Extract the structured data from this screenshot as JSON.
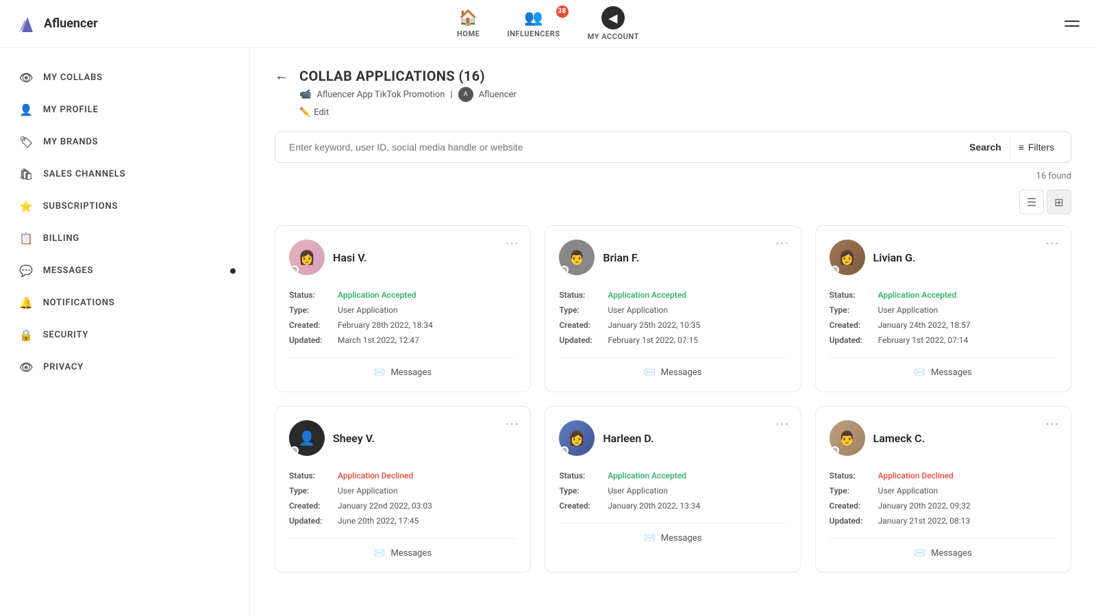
{
  "app": {
    "name": "Afluencer"
  },
  "topNav": {
    "badge": "38",
    "items": [
      {
        "id": "home",
        "label": "HOME",
        "icon": "🏠"
      },
      {
        "id": "influencers",
        "label": "INFLUENCERS",
        "icon": "👥"
      },
      {
        "id": "my-account",
        "label": "MY ACCOUNT",
        "icon": "◀"
      }
    ]
  },
  "sidebar": {
    "items": [
      {
        "id": "my-collabs",
        "label": "MY COLLABS",
        "icon": "👁",
        "dot": false
      },
      {
        "id": "my-profile",
        "label": "MY PROFILE",
        "icon": "👤",
        "dot": false
      },
      {
        "id": "my-brands",
        "label": "MY BRANDS",
        "icon": "🏷",
        "dot": false
      },
      {
        "id": "sales-channels",
        "label": "SALES CHANNELS",
        "icon": "🛍",
        "dot": false
      },
      {
        "id": "subscriptions",
        "label": "SUBSCRIPTIONS",
        "icon": "⭐",
        "dot": false
      },
      {
        "id": "billing",
        "label": "BILLING",
        "icon": "📋",
        "dot": false
      },
      {
        "id": "messages",
        "label": "MESSAGES",
        "icon": "💬",
        "dot": true
      },
      {
        "id": "notifications",
        "label": "NOTIFICATIONS",
        "icon": "🔔",
        "dot": false
      },
      {
        "id": "security",
        "label": "SECURITY",
        "icon": "🔒",
        "dot": false
      },
      {
        "id": "privacy",
        "label": "PRIVACY",
        "icon": "👁",
        "dot": false
      }
    ]
  },
  "page": {
    "title": "COLLAB APPLICATIONS (16)",
    "collab_name": "Afluencer App TikTok Promotion",
    "brand_name": "Afluencer",
    "edit_label": "Edit",
    "search_placeholder": "Enter keyword, user ID, social media handle or website",
    "search_button": "Search",
    "filter_button": "Filters",
    "found_count": "16 found",
    "back_icon": "←"
  },
  "cards": [
    {
      "id": "hasi-v",
      "name": "Hasi V.",
      "status": "Application Accepted",
      "status_type": "accepted",
      "type": "User Application",
      "created": "February 28th 2022, 18:34",
      "updated": "March 1st 2022, 12:47",
      "avatar_color": "av-pink",
      "messages_label": "Messages"
    },
    {
      "id": "brian-f",
      "name": "Brian F.",
      "status": "Application Accepted",
      "status_type": "accepted",
      "type": "User Application",
      "created": "January 25th 2022, 10:35",
      "updated": "February 1st 2022, 07:15",
      "avatar_color": "av-gray",
      "messages_label": "Messages"
    },
    {
      "id": "livian-g",
      "name": "Livian G.",
      "status": "Application Accepted",
      "status_type": "accepted",
      "type": "User Application",
      "created": "January 24th 2022, 18:57",
      "updated": "February 1st 2022, 07:14",
      "avatar_color": "av-brown",
      "messages_label": "Messages"
    },
    {
      "id": "sheey-v",
      "name": "Sheey V.",
      "status": "Application Declined",
      "status_type": "declined",
      "type": "User Application",
      "created": "January 22nd 2022, 03:03",
      "updated": "June 20th 2022, 17:45",
      "avatar_color": "av-dark",
      "messages_label": "Messages"
    },
    {
      "id": "harleen-d",
      "name": "Harleen D.",
      "status": "Application Accepted",
      "status_type": "accepted",
      "type": "User Application",
      "created": "January 20th 2022, 13:34",
      "updated": "",
      "avatar_color": "av-blue",
      "messages_label": "Messages"
    },
    {
      "id": "lameck-c",
      "name": "Lameck C.",
      "status": "Application Declined",
      "status_type": "declined",
      "type": "User Application",
      "created": "January 20th 2022, 09:32",
      "updated": "January 21st 2022, 08:13",
      "avatar_color": "av-tan",
      "messages_label": "Messages"
    }
  ],
  "labels": {
    "status": "Status:",
    "type": "Type:",
    "created": "Created:",
    "updated": "Updated:"
  }
}
